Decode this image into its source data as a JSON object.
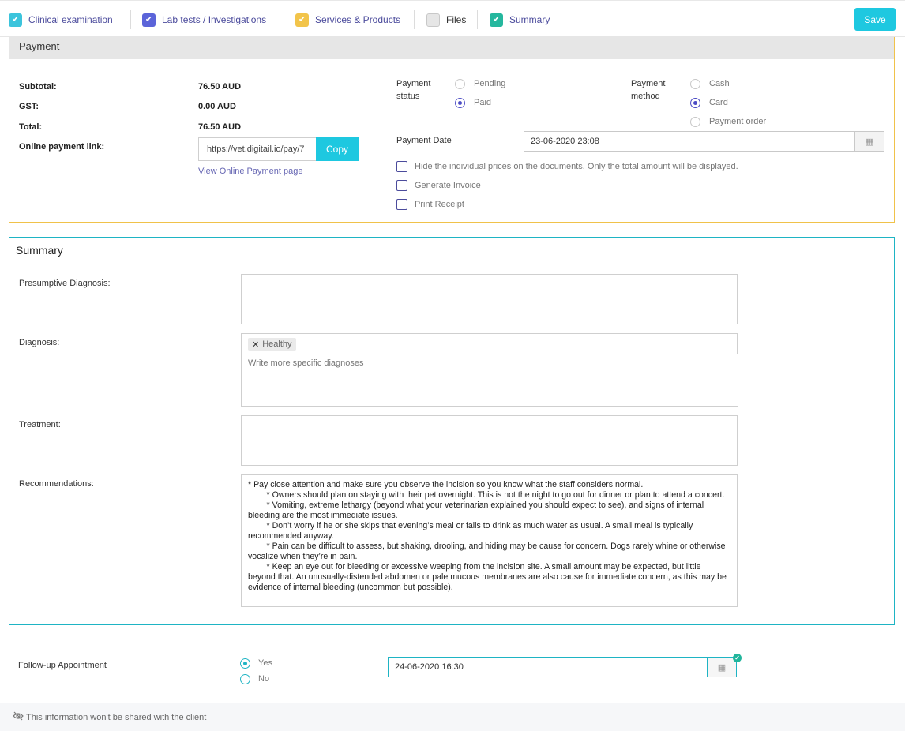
{
  "tabs": [
    {
      "label": "Clinical examination",
      "color": "#3cc4dc",
      "checked": true
    },
    {
      "label": "Lab tests / Investigations",
      "color": "#5b64d9",
      "checked": true
    },
    {
      "label": "Services & Products",
      "color": "#f2c44a",
      "checked": true
    },
    {
      "label": "Files",
      "color": "#e6e6e6",
      "checked": false
    },
    {
      "label": "Summary",
      "color": "#25b79e",
      "checked": true
    }
  ],
  "save_label": "Save",
  "payment": {
    "title": "Payment",
    "subtotal_label": "Subtotal:",
    "subtotal_value": "76.50 AUD",
    "gst_label": "GST:",
    "gst_value": "0.00 AUD",
    "total_label": "Total:",
    "total_value": "76.50 AUD",
    "link_label": "Online payment link:",
    "link_value": "https://vet.digitail.io/pay/7",
    "copy_label": "Copy",
    "view_link": "View Online Payment page",
    "status_label": "Payment status",
    "status_options": [
      "Pending",
      "Paid"
    ],
    "status_selected": "Paid",
    "method_label": "Payment method",
    "method_options": [
      "Cash",
      "Card",
      "Payment order"
    ],
    "method_selected": "Card",
    "date_label": "Payment Date",
    "date_value": "23-06-2020 23:08",
    "checkboxes": [
      "Hide the individual prices on the documents. Only the total amount will be displayed.",
      "Generate Invoice",
      "Print Receipt"
    ]
  },
  "summary": {
    "title": "Summary",
    "presumptive_label": "Presumptive Diagnosis:",
    "diagnosis_label": "Diagnosis:",
    "diagnosis_tag": "Healthy",
    "diagnosis_placeholder": "Write more specific diagnoses",
    "treatment_label": "Treatment:",
    "recommendations_label": "Recommendations:",
    "recommendations_text": "* Pay close attention and make sure you observe the incision so you know what the staff considers normal.\n        * Owners should plan on staying with their pet overnight. This is not the night to go out for dinner or plan to attend a concert.\n        * Vomiting, extreme lethargy (beyond what your veterinarian explained you should expect to see), and signs of internal bleeding are the most immediate issues.\n        * Don’t worry if he or she skips that evening’s meal or fails to drink as much water as usual. A small meal is typically recommended anyway.\n        * Pain can be difficult to assess, but shaking, drooling, and hiding may be cause for concern. Dogs rarely whine or otherwise vocalize when they’re in pain.\n        * Keep an eye out for bleeding or excessive weeping from the incision site. A small amount may be expected, but little beyond that. An unusually-distended abdomen or pale mucous membranes are also cause for immediate concern, as this may be evidence of internal bleeding (uncommon but possible)."
  },
  "followup": {
    "label": "Follow-up Appointment",
    "options": [
      "Yes",
      "No"
    ],
    "selected": "Yes",
    "date_value": "24-06-2020 16:30"
  },
  "note": "This information won't be shared with the client"
}
